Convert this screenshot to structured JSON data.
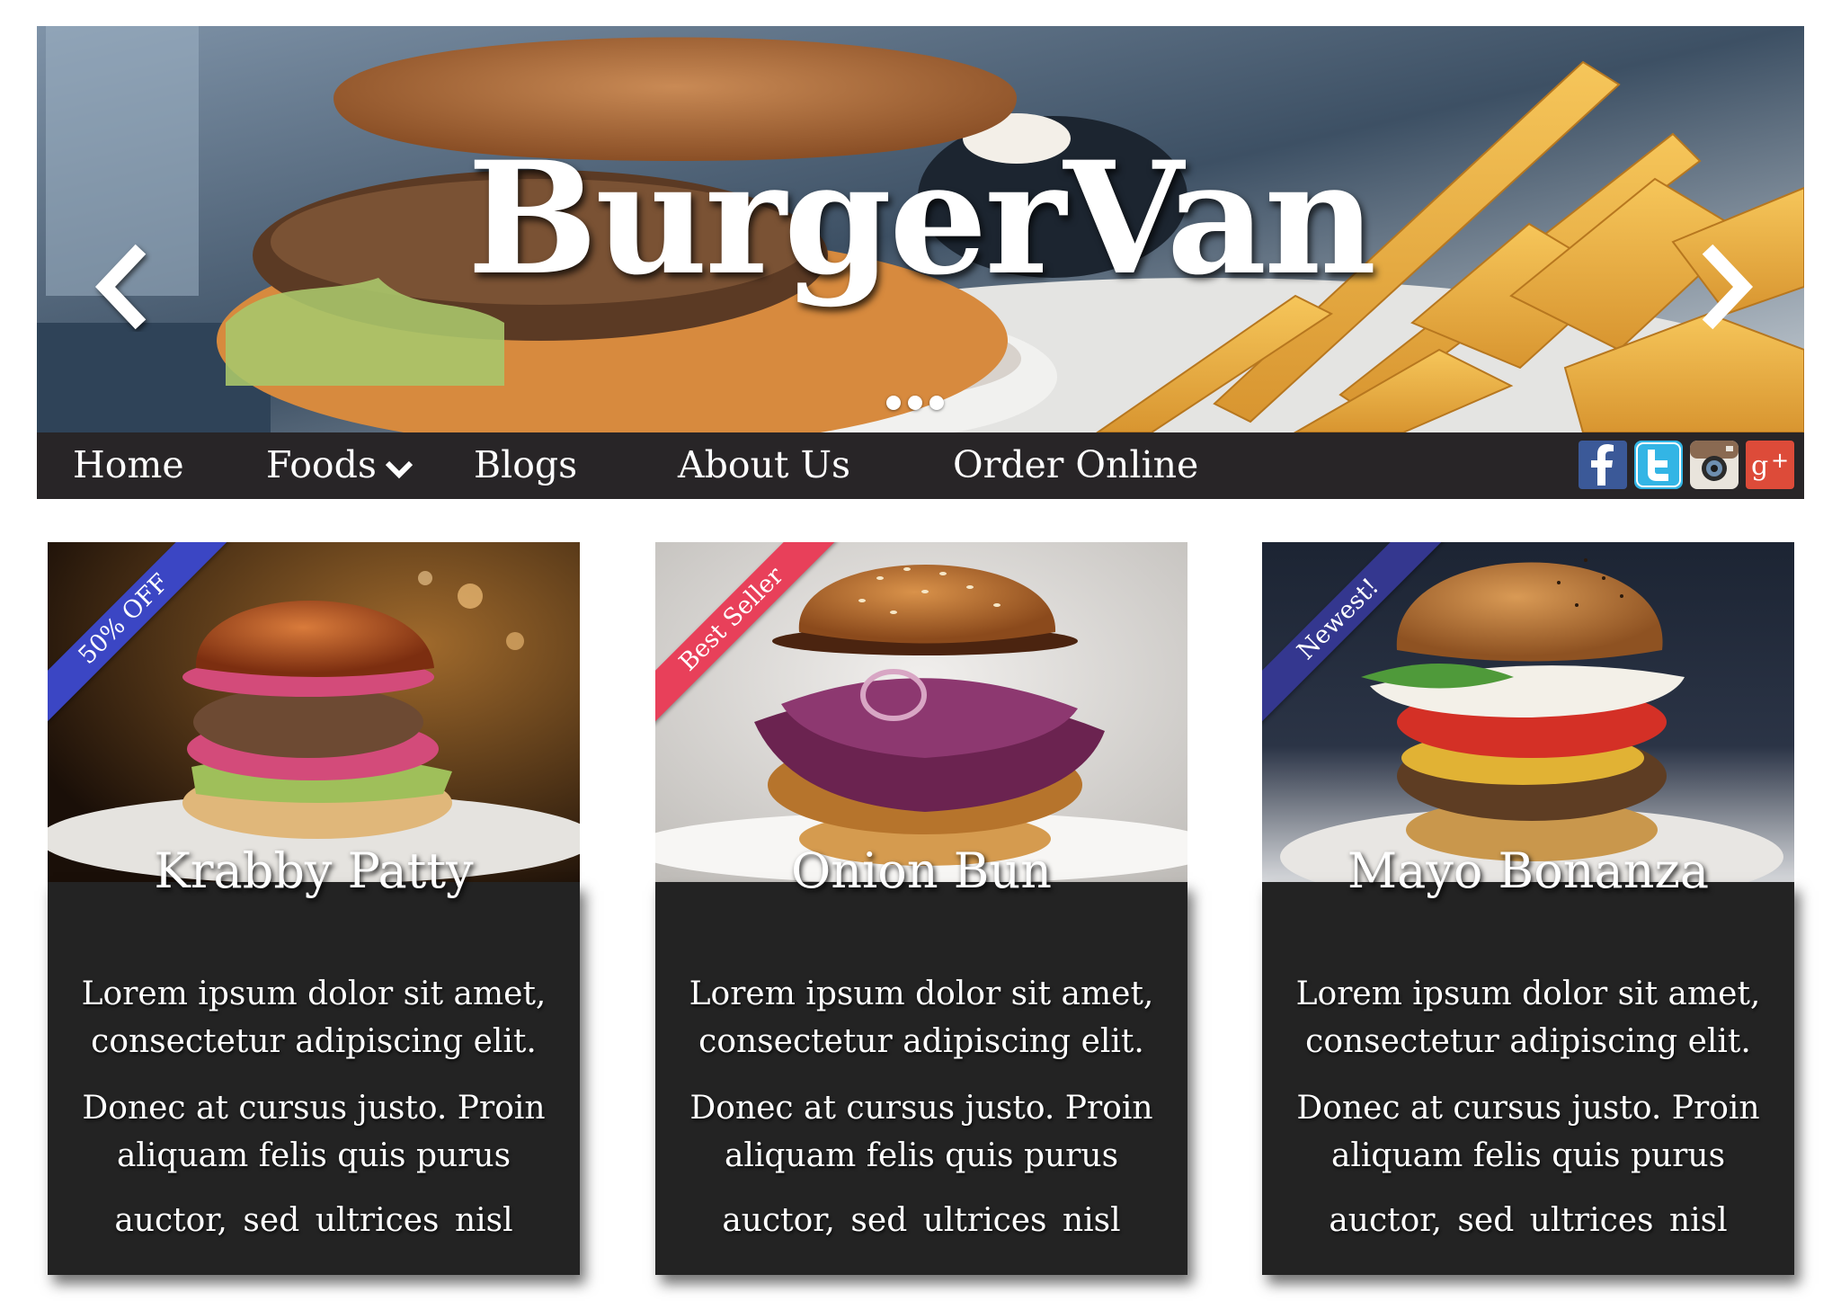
{
  "brand": {
    "title": "BurgerVan"
  },
  "hero": {
    "prev_icon": "chevron-left-icon",
    "next_icon": "chevron-right-icon",
    "slide_count": 3
  },
  "nav": {
    "items": [
      {
        "label": "Home"
      },
      {
        "label": "Foods",
        "icon": "chevron-down-icon"
      },
      {
        "label": "Blogs"
      },
      {
        "label": "About Us"
      },
      {
        "label": "Order Online"
      }
    ]
  },
  "social": [
    {
      "name": "facebook-icon",
      "color": "#3b5998"
    },
    {
      "name": "twitter-icon",
      "color": "#33b5e5"
    },
    {
      "name": "instagram-icon",
      "color": "#8a6a52"
    },
    {
      "name": "google-plus-icon",
      "color": "#dd4b39"
    }
  ],
  "cards": [
    {
      "ribbon": "50% OFF",
      "ribbon_color": "#3b46c4",
      "title": "Krabby Patty",
      "text_1a": "Lorem ipsum dolor sit amet,",
      "text_1b": "consectetur adipiscing elit.",
      "text_2a": "Donec at cursus justo. Proin",
      "text_2b": "aliquam felis quis purus",
      "text_3": "auctor, sed ultrices nisl"
    },
    {
      "ribbon": "Best Seller",
      "ribbon_color": "#e8405a",
      "title": "Onion Bun",
      "text_1a": "Lorem ipsum dolor sit amet,",
      "text_1b": "consectetur adipiscing elit.",
      "text_2a": "Donec at cursus justo. Proin",
      "text_2b": "aliquam felis quis purus",
      "text_3": "auctor, sed ultrices nisl"
    },
    {
      "ribbon": "Newest!",
      "ribbon_color": "#34378f",
      "title": "Mayo Bonanza",
      "text_1a": "Lorem ipsum dolor sit amet,",
      "text_1b": "consectetur adipiscing elit.",
      "text_2a": "Donec at cursus justo. Proin",
      "text_2b": "aliquam felis quis purus",
      "text_3": "auctor, sed ultrices nisl"
    }
  ],
  "colors": {
    "nav_bg": "#282527",
    "card_bg": "#232323",
    "text": "#ffffff"
  }
}
